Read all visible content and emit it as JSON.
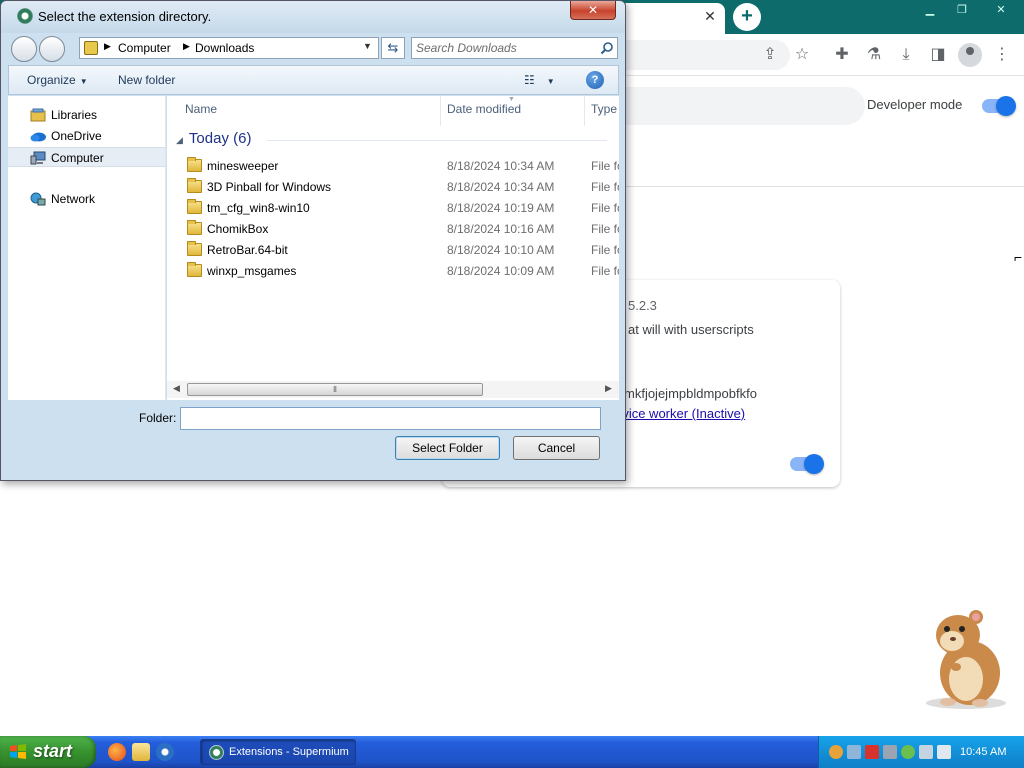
{
  "browser": {
    "developer_mode_label": "Developer mode",
    "extension_card": {
      "version": "5.2.3",
      "description": "at will with userscripts",
      "id": "mkfjojejmpbldmpobfkfo",
      "service_worker_link": "rvice worker (Inactive)"
    },
    "colors": {
      "titlebar": "#0e6b6b",
      "toggle_on": "#1a73e8"
    }
  },
  "dialog": {
    "title": "Select the extension directory.",
    "close_glyph": "✕",
    "address": {
      "crumbs": [
        "Computer",
        "Downloads"
      ]
    },
    "search": {
      "placeholder": "Search Downloads"
    },
    "command_bar": {
      "organize": "Organize",
      "new_folder": "New folder"
    },
    "navigation": [
      {
        "label": "Libraries",
        "icon": "libraries-icon"
      },
      {
        "label": "OneDrive",
        "icon": "onedrive-icon"
      },
      {
        "label": "Computer",
        "icon": "computer-icon",
        "selected": true
      },
      {
        "label": "Network",
        "icon": "network-icon"
      }
    ],
    "columns": {
      "name": "Name",
      "date_modified": "Date modified",
      "type": "Type"
    },
    "group_header": "Today (6)",
    "files": [
      {
        "name": "minesweeper",
        "date": "8/18/2024 10:34 AM",
        "type": "File fo"
      },
      {
        "name": "3D Pinball for Windows",
        "date": "8/18/2024 10:34 AM",
        "type": "File fo"
      },
      {
        "name": "tm_cfg_win8-win10",
        "date": "8/18/2024 10:19 AM",
        "type": "File fo"
      },
      {
        "name": "ChomikBox",
        "date": "8/18/2024 10:16 AM",
        "type": "File fo"
      },
      {
        "name": "RetroBar.64-bit",
        "date": "8/18/2024 10:10 AM",
        "type": "File fo"
      },
      {
        "name": "winxp_msgames",
        "date": "8/18/2024 10:09 AM",
        "type": "File fo"
      }
    ],
    "folder_label": "Folder:",
    "folder_value": "",
    "select_button": "Select Folder",
    "cancel_button": "Cancel"
  },
  "taskbar": {
    "start_label": "start",
    "task_button_label": "Extensions - Supermium",
    "clock": "10:45 AM",
    "colors": {
      "bar": "#245edb",
      "start": "#36922f",
      "tray": "#1290d9"
    }
  }
}
